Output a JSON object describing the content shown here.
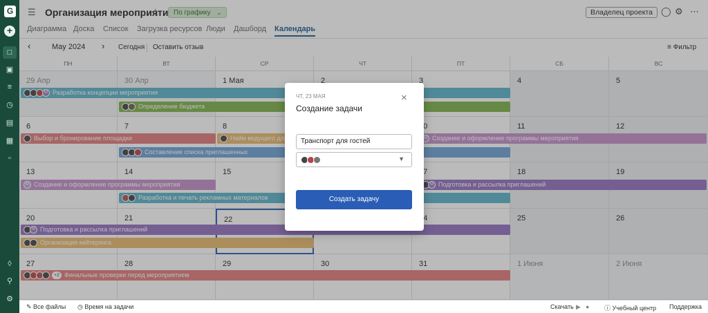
{
  "sidebar": {
    "logo": "G",
    "plus": "+",
    "icons": [
      "folder-icon",
      "briefcase-icon",
      "list-icon",
      "clock-icon",
      "document-icon",
      "grid-icon",
      "chat-icon",
      "bell-icon",
      "search-icon",
      "gear-icon"
    ]
  },
  "header": {
    "title": "Организация мероприятия",
    "status": "По графику",
    "owner": "Владелец проекта"
  },
  "tabs": [
    "Диаграмма",
    "Доска",
    "Список",
    "Загрузка ресурсов",
    "Люди",
    "Дашборд",
    "Календарь"
  ],
  "toolbar": {
    "prev": "‹",
    "next": "›",
    "month": "May 2024",
    "today": "Сегодня",
    "feedback": "Оставить отзыв",
    "filter": "Фильтр"
  },
  "weekdays": [
    "ПН",
    "ВТ",
    "СР",
    "ЧТ",
    "ПТ",
    "СБ",
    "ВС"
  ],
  "weeks": [
    [
      "29 Апр",
      "30 Апр",
      "1 Мая",
      "2",
      "3",
      "4",
      "5"
    ],
    [
      "6",
      "7",
      "8",
      "9",
      "10",
      "11",
      "12"
    ],
    [
      "13",
      "14",
      "15",
      "16",
      "17",
      "18",
      "19"
    ],
    [
      "20",
      "21",
      "22",
      "23",
      "24",
      "25",
      "26"
    ],
    [
      "27",
      "28",
      "29",
      "30",
      "31",
      "1 Июня",
      "2 Июня"
    ]
  ],
  "events": [
    {
      "label": "Разработка концепции мероприятия",
      "color": "#5bb3c8",
      "badge": "M"
    },
    {
      "label": "Определение бюджета",
      "color": "#7db34a"
    },
    {
      "label": "Выбор и бронирование площадки",
      "color": "#e07c7c"
    },
    {
      "label": "Найм ведущего для",
      "color": "#e8b86d"
    },
    {
      "label": "Создание и оформление программы мероприятия",
      "color": "#c490c9",
      "badge": "M"
    },
    {
      "label": "Составление списка приглашенных",
      "color": "#6ea1d8"
    },
    {
      "label": "Создание и оформление программы мероприятия",
      "color": "#c490c9",
      "badge": "M"
    },
    {
      "label": "Подготовка и рассылка приглашений",
      "color": "#9270c0",
      "badge": "M"
    },
    {
      "label": "Разработка и печать рекламных материалов",
      "color": "#5bb3c8"
    },
    {
      "label": "Подготовка и рассылка приглашений",
      "color": "#9270c0",
      "badge": "M"
    },
    {
      "label": "Организация кейтеринга",
      "color": "#e8b86d"
    },
    {
      "label": "Финальные проверки перед мероприятием",
      "color": "#e07c7c",
      "more": "+2"
    }
  ],
  "modal": {
    "date": "ЧТ, 23 МАЯ",
    "title": "Создание задачи",
    "task_value": "Транспорт для гостей",
    "create_button": "Создать задачу",
    "close": "×"
  },
  "footer": {
    "all_files": "Все файлы",
    "time_on_tasks": "Время на задачи",
    "download": "Скачать",
    "learning_center": "Учебный центр",
    "support": "Поддержка"
  }
}
